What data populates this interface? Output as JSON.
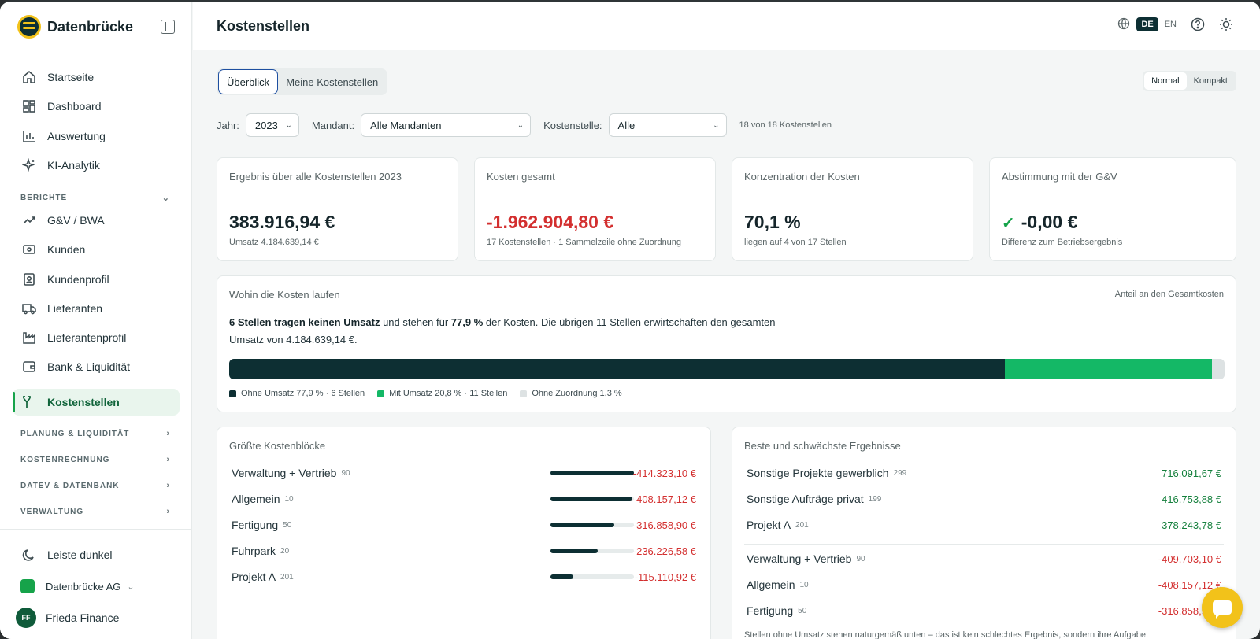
{
  "app": {
    "brand": "Datenbrücke"
  },
  "sidebar": {
    "items": [
      {
        "label": "Startseite",
        "icon": "home-icon"
      },
      {
        "label": "Dashboard",
        "icon": "dashboard-icon"
      },
      {
        "label": "Auswertung",
        "icon": "bar-chart-icon"
      },
      {
        "label": "KI-Analytik",
        "icon": "sparkle-icon"
      }
    ],
    "reports_label": "BERICHTE",
    "report_items": [
      {
        "label": "G&V / BWA",
        "icon": "trend-icon"
      },
      {
        "label": "Kunden",
        "icon": "cash-icon"
      },
      {
        "label": "Kundenprofil",
        "icon": "profile-icon"
      },
      {
        "label": "Lieferanten",
        "icon": "truck-icon"
      },
      {
        "label": "Lieferantenprofil",
        "icon": "factory-icon"
      },
      {
        "label": "Bank & Liquidität",
        "icon": "wallet-icon"
      },
      {
        "label": "Kostenstellen",
        "icon": "split-icon",
        "active": true
      }
    ],
    "sections": [
      "PLANUNG & LIQUIDITÄT",
      "KOSTENRECHNUNG",
      "DATEV & DATENBANK",
      "VERWALTUNG"
    ],
    "dark_mode_label": "Leiste dunkel",
    "org_name": "Datenbrücke AG",
    "user_initials": "FF",
    "user_name": "Frieda Finance"
  },
  "header": {
    "title": "Kostenstellen",
    "lang_active": "DE",
    "lang_other": "EN"
  },
  "tabs": [
    {
      "label": "Überblick",
      "active": true
    },
    {
      "label": "Meine Kostenstellen",
      "active": false
    }
  ],
  "density": {
    "normal": "Normal",
    "compact": "Kompakt"
  },
  "filters": {
    "year_label": "Jahr:",
    "year_value": "2023",
    "client_label": "Mandant:",
    "client_value": "Alle Mandanten",
    "cost_center_label": "Kostenstelle:",
    "cost_center_value": "Alle",
    "count_text": "18 von 18 Kostenstellen"
  },
  "kpis": [
    {
      "title": "Ergebnis über alle Kostenstellen 2023",
      "value": "383.916,94 €",
      "sub": "Umsatz 4.184.639,14 €"
    },
    {
      "title": "Kosten gesamt",
      "value": "-1.962.904,80 €",
      "sub": "17 Kostenstellen · 1 Sammelzeile ohne Zuordnung"
    },
    {
      "title": "Konzentration der Kosten",
      "value": "70,1 %",
      "sub": "liegen auf 4 von 17 Stellen"
    },
    {
      "title": "Abstimmung mit der G&V",
      "value": "-0,00 €",
      "sub": "Differenz zum Betriebsergebnis"
    }
  ],
  "flow": {
    "title": "Wohin die Kosten laufen",
    "right_label": "Anteil an den Gesamtkosten",
    "text_bold1": "6 Stellen tragen keinen Umsatz",
    "text_mid": " und stehen für ",
    "text_bold2": "77,9 %",
    "text_end": " der Kosten. Die übrigen 11 Stellen erwirtschaften den gesamten Umsatz von 4.184.639,14 €.",
    "segments": [
      {
        "label": "Ohne Umsatz 77,9 % · 6 Stellen",
        "share": 77.9,
        "color": "#0d2f33"
      },
      {
        "label": "Mit Umsatz 20,8 % · 11 Stellen",
        "share": 20.8,
        "color": "#14b866"
      },
      {
        "label": "Ohne Zuordnung 1,3 %",
        "share": 1.3,
        "color": "#dde2e3"
      }
    ]
  },
  "blocks": {
    "title": "Größte Kostenblöcke",
    "rows": [
      {
        "name": "Verwaltung + Vertrieb",
        "code": "90",
        "amount": "-414.323,10 €",
        "share": 1.0
      },
      {
        "name": "Allgemein",
        "code": "10",
        "amount": "-408.157,12 €",
        "share": 0.985
      },
      {
        "name": "Fertigung",
        "code": "50",
        "amount": "-316.858,90 €",
        "share": 0.765
      },
      {
        "name": "Fuhrpark",
        "code": "20",
        "amount": "-236.226,58 €",
        "share": 0.57
      },
      {
        "name": "Projekt A",
        "code": "201",
        "amount": "-115.110,92 €",
        "share": 0.278
      }
    ]
  },
  "results": {
    "title": "Beste und schwächste Ergebnisse",
    "best": [
      {
        "name": "Sonstige Projekte gewerblich",
        "code": "299",
        "amount": "716.091,67 €"
      },
      {
        "name": "Sonstige Aufträge privat",
        "code": "199",
        "amount": "416.753,88 €"
      },
      {
        "name": "Projekt A",
        "code": "201",
        "amount": "378.243,78 €"
      }
    ],
    "worst": [
      {
        "name": "Verwaltung + Vertrieb",
        "code": "90",
        "amount": "-409.703,10 €"
      },
      {
        "name": "Allgemein",
        "code": "10",
        "amount": "-408.157,12 €"
      },
      {
        "name": "Fertigung",
        "code": "50",
        "amount": "-316.858,90 €"
      }
    ],
    "footnote": "Stellen ohne Umsatz stehen naturgemäß unten – das ist kein schlechtes Ergebnis, sondern ihre Aufgabe."
  },
  "colors": {
    "accent": "#16a34a",
    "brand": "#0d2f33",
    "negative": "#d32f2f",
    "positive": "#15803d",
    "logo": "#f2c21a"
  }
}
